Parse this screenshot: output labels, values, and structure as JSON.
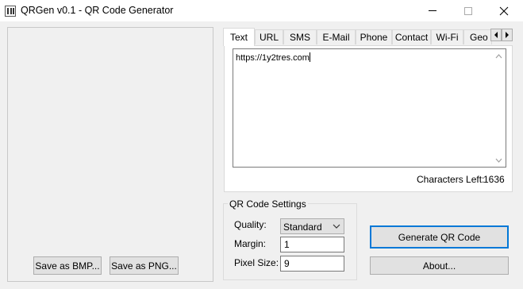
{
  "window": {
    "title": "QRGen v0.1 - QR Code Generator",
    "min_icon": "minimize-icon",
    "max_icon": "maximize-icon",
    "close_icon": "close-icon"
  },
  "left_panel": {
    "save_bmp_label": "Save as BMP...",
    "save_png_label": "Save as PNG..."
  },
  "tabs": [
    {
      "label": "Text",
      "active": true
    },
    {
      "label": "URL",
      "active": false
    },
    {
      "label": "SMS",
      "active": false
    },
    {
      "label": "E-Mail",
      "active": false
    },
    {
      "label": "Phone",
      "active": false
    },
    {
      "label": "Contact",
      "active": false
    },
    {
      "label": "Wi-Fi",
      "active": false
    },
    {
      "label": "Geo",
      "active": false
    }
  ],
  "tab_scroll": {
    "left_icon": "arrow-left-icon",
    "right_icon": "arrow-right-icon"
  },
  "text_tab": {
    "content": "https://1y2tres.com",
    "chars_left_label": "Characters Left:",
    "chars_left_value": "1636"
  },
  "settings": {
    "legend": "QR Code Settings",
    "quality_label": "Quality:",
    "quality_value": "Standard",
    "margin_label": "Margin:",
    "margin_value": "1",
    "pixel_size_label": "Pixel Size:",
    "pixel_size_value": "9"
  },
  "actions": {
    "generate_label": "Generate QR Code",
    "about_label": "About..."
  },
  "colors": {
    "focus_border": "#0078d7",
    "window_bg": "#f0f0f0",
    "button_bg": "#e1e1e1"
  }
}
